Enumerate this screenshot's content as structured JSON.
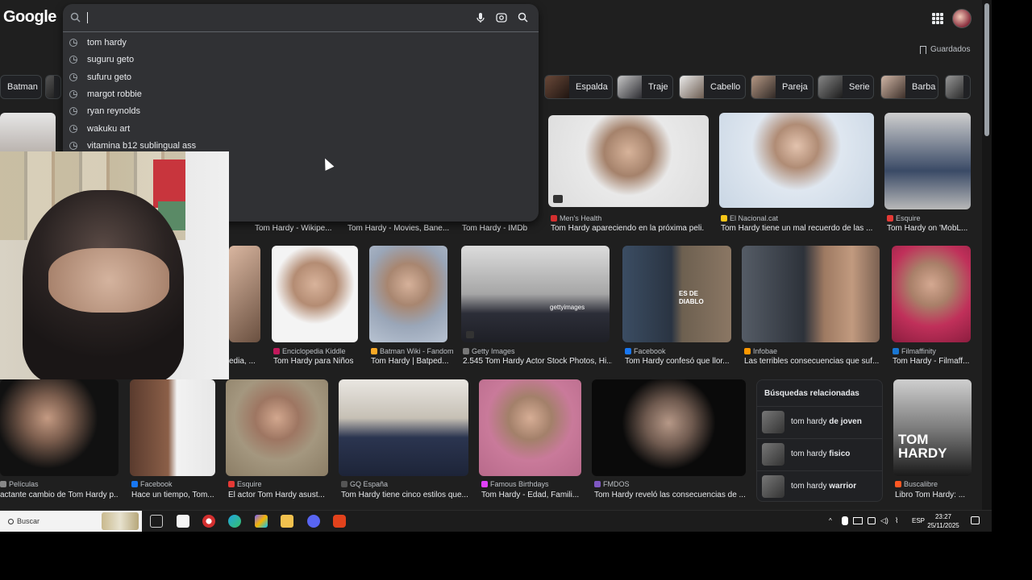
{
  "header": {
    "logo_text": "Google",
    "saved_label": "Guardados"
  },
  "search": {
    "query": "",
    "suggestions": [
      "tom hardy",
      "suguru geto",
      "sufuru geto",
      "margot robbie",
      "ryan reynolds",
      "wakuku art",
      "vitamina b12 sublingual ass"
    ]
  },
  "chips": [
    {
      "label": "Batman"
    },
    {
      "label": "Espalda"
    },
    {
      "label": "Traje"
    },
    {
      "label": "Cabello"
    },
    {
      "label": "Pareja"
    },
    {
      "label": "Serie"
    },
    {
      "label": "Barba"
    }
  ],
  "results_row1": [
    {
      "caption": "Tom Hardy - Wikipe..."
    },
    {
      "caption": "Tom Hardy - Movies, Bane..."
    },
    {
      "caption": "Tom Hardy - IMDb"
    },
    {
      "source": "Men's Health",
      "caption": "Tom Hardy apareciendo en la próxima peli..."
    },
    {
      "source": "El Nacional.cat",
      "caption": "Tom Hardy tiene un mal recuerdo de las ..."
    },
    {
      "source": "Esquire",
      "caption": "Tom Hardy on 'MobL..."
    }
  ],
  "results_row2": [
    {
      "caption": "edia, ..."
    },
    {
      "source": "Enciclopedia Kiddle",
      "caption": "Tom Hardy para Niños"
    },
    {
      "source": "Batman Wiki - Fandom",
      "caption": "Tom Hardy | Batped..."
    },
    {
      "source": "Getty Images",
      "caption": "2.545 Tom Hardy Actor Stock Photos, Hi..."
    },
    {
      "source": "Facebook",
      "caption": "Tom Hardy confesó que llor..."
    },
    {
      "source": "Infobae",
      "caption": "Las terribles consecuencias que suf..."
    },
    {
      "source": "Filmaffinity",
      "caption": "Tom Hardy - Filmaff..."
    }
  ],
  "results_row3": [
    {
      "source": "Películas",
      "caption": "actante cambio de Tom Hardy p..."
    },
    {
      "source": "Facebook",
      "caption": "Hace un tiempo, Tom..."
    },
    {
      "source": "Esquire",
      "caption": "El actor Tom Hardy asust..."
    },
    {
      "source": "GQ España",
      "caption": "Tom Hardy tiene cinco estilos que..."
    },
    {
      "source": "Famous Birthdays",
      "caption": "Tom Hardy - Edad, Famili..."
    },
    {
      "source": "FMDOS",
      "caption": "Tom Hardy reveló las consecuencias de ..."
    },
    {
      "source": "Buscalibre",
      "caption": "Libro Tom Hardy: ..."
    }
  ],
  "related": {
    "title": "Búsquedas relacionadas",
    "items": [
      {
        "prefix": "tom hardy ",
        "bold": "de joven"
      },
      {
        "prefix": "tom hardy ",
        "bold": "fisico"
      },
      {
        "prefix": "tom hardy ",
        "bold": "warrior"
      }
    ]
  },
  "image_overlay_text": {
    "diablo": "ES DE DIABLO",
    "book_title": "TOM HARDY",
    "getty": "gettyimages"
  },
  "taskbar": {
    "search_placeholder": "Buscar",
    "language": "ESP",
    "time": "23:27",
    "date": "25/11/2025"
  },
  "colors": {
    "page_bg": "#1f1f1f",
    "search_bg": "#303134",
    "text": "#e8eaed",
    "muted": "#bdc1c6"
  }
}
